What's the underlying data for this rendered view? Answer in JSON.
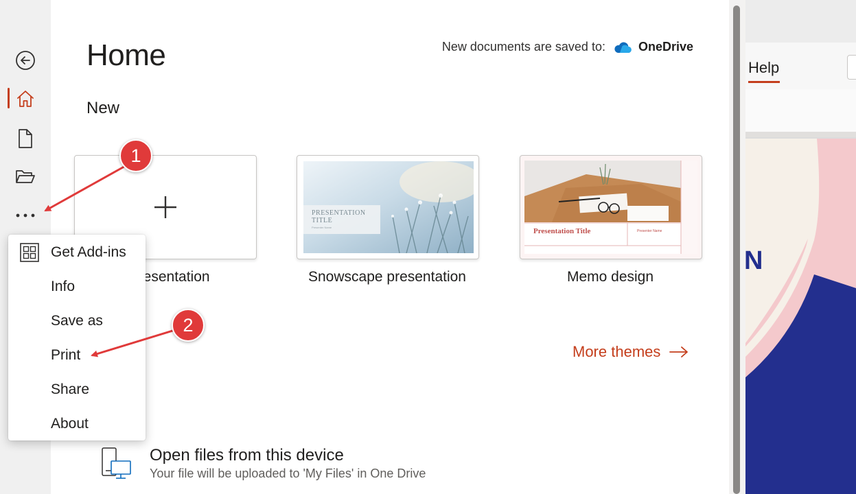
{
  "rail": {
    "items": [
      {
        "name": "back",
        "icon": "back-arrow-icon"
      },
      {
        "name": "home",
        "icon": "home-icon",
        "active": true
      },
      {
        "name": "new",
        "icon": "new-document-icon"
      },
      {
        "name": "open",
        "icon": "folder-open-icon"
      },
      {
        "name": "more",
        "icon": "ellipsis-icon"
      }
    ]
  },
  "header": {
    "title": "Home",
    "saved_to_label": "New documents are saved to:",
    "saved_to_service": "OneDrive"
  },
  "new_section": {
    "title": "New",
    "templates": [
      {
        "label": "presentation",
        "type": "blank"
      },
      {
        "label": "Snowscape presentation",
        "type": "snowscape",
        "thumb_title": "PRESENTATION TITLE",
        "thumb_subtitle": "Presenter Name"
      },
      {
        "label": "Memo design",
        "type": "memo",
        "thumb_title": "Presentation Title",
        "thumb_subtitle": "Presenter Name"
      }
    ],
    "more_themes": "More themes"
  },
  "open_device": {
    "title": "Open files from this device",
    "subtitle": "Your file will be uploaded to 'My Files' in One Drive"
  },
  "menu": {
    "items": [
      {
        "label": "Get Add-ins",
        "icon": "add-ins-grid-icon"
      },
      {
        "label": "Info"
      },
      {
        "label": "Save as"
      },
      {
        "label": "Print"
      },
      {
        "label": "Share"
      },
      {
        "label": "About"
      }
    ]
  },
  "background_app": {
    "tab_label": "Help"
  },
  "annotations": {
    "marker_1": "1",
    "marker_2": "2"
  },
  "colors": {
    "accent": "#c43e1c",
    "marker": "#e03a3a",
    "rail_bg": "#f0f0f0",
    "onedrive": "#0f6cbd",
    "slide_navy": "#232f8e",
    "slide_pink": "#f4c9cc"
  }
}
